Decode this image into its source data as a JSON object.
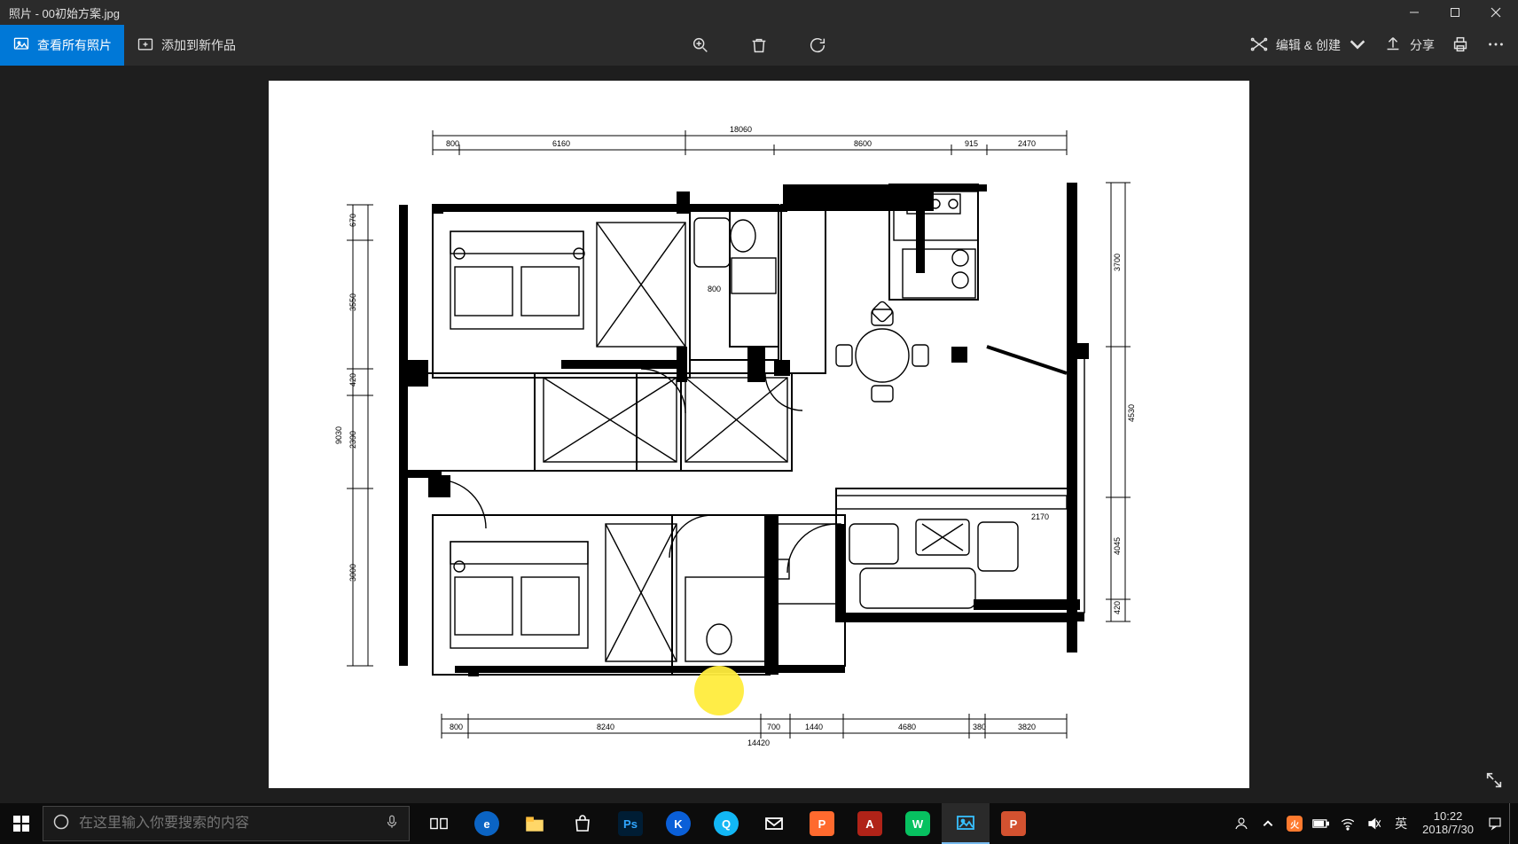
{
  "window": {
    "title": "照片 - 00初始方案.jpg"
  },
  "toolbar": {
    "view_all_label": "查看所有照片",
    "add_to_collection_label": "添加到新作品",
    "edit_create_label": "编辑 & 创建",
    "share_label": "分享"
  },
  "search": {
    "placeholder": "在这里输入你要搜索的内容"
  },
  "clock": {
    "time": "10:22",
    "date": "2018/7/30"
  },
  "ime": {
    "label": "英"
  },
  "floorplan": {
    "dims_top": [
      "800",
      "6160",
      "18060",
      "8600",
      "915",
      "2470"
    ],
    "dims_left": [
      "670",
      "3550",
      "420",
      "9030",
      "2390",
      "3000"
    ],
    "dims_right": [
      "3700",
      "4530",
      "4045",
      "420"
    ],
    "dims_bottom": [
      "800",
      "8240",
      "700",
      "1440",
      "4680",
      "380",
      "3820",
      "14420"
    ],
    "inner_labels": [
      "800",
      "2170"
    ]
  }
}
